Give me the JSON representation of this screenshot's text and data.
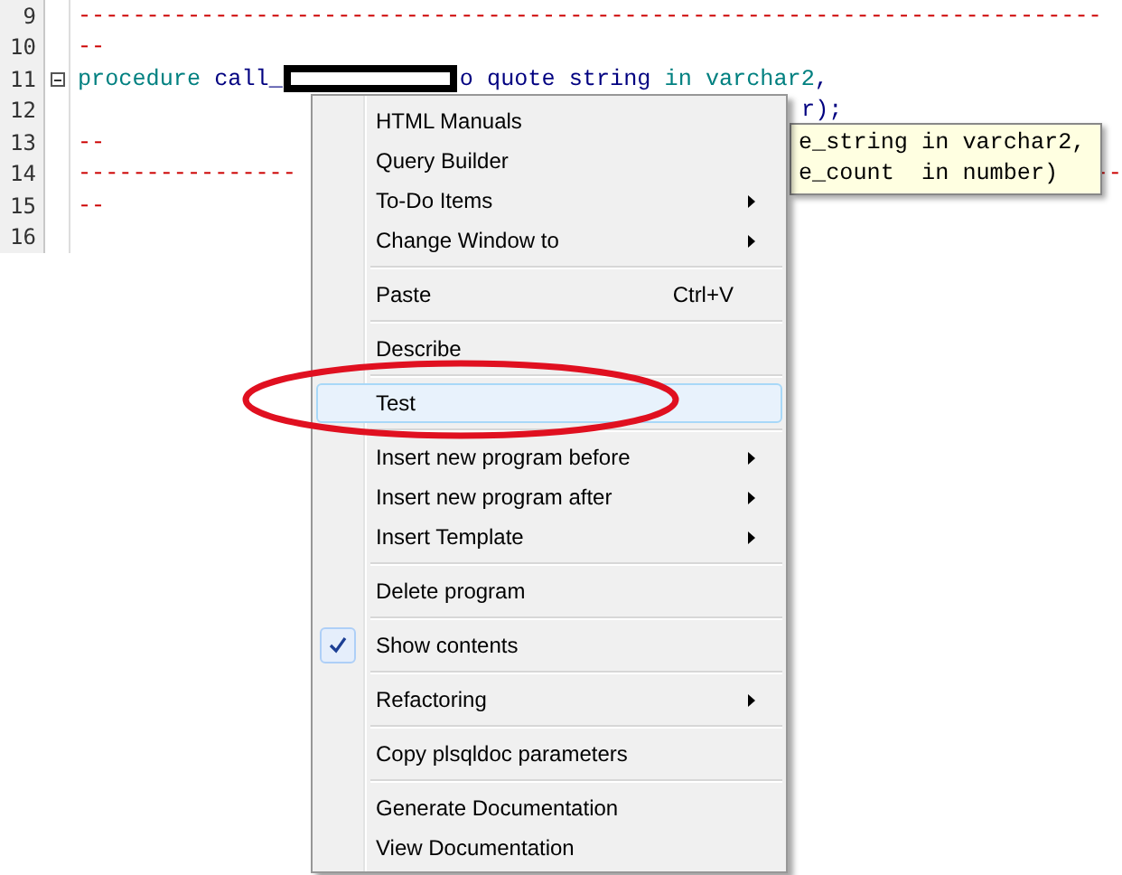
{
  "editor": {
    "lines": [
      {
        "number": "9",
        "fold_toggle": false,
        "segments": [
          {
            "kind": "comment",
            "text": "---------------------------------------------------------------------------"
          }
        ]
      },
      {
        "number": "10",
        "fold_toggle": false,
        "segments": [
          {
            "kind": "comment",
            "text": "--"
          }
        ]
      },
      {
        "number": "11",
        "fold_toggle": true,
        "segments": [
          {
            "kind": "keyword",
            "text": "procedure"
          },
          {
            "kind": "plain",
            "text": " call_"
          },
          {
            "kind": "redacted"
          },
          {
            "kind": "plain",
            "text": "o quote string "
          },
          {
            "kind": "keyword",
            "text": "in varchar2"
          },
          {
            "kind": "plain",
            "text": ","
          }
        ]
      },
      {
        "number": "12",
        "fold_toggle": false,
        "segments": [
          {
            "kind": "plain",
            "text": "                                                     r);"
          }
        ]
      },
      {
        "number": "13",
        "fold_toggle": false,
        "segments": [
          {
            "kind": "comment",
            "text": "--"
          }
        ]
      },
      {
        "number": "14",
        "fold_toggle": false,
        "segments": [
          {
            "kind": "comment",
            "text": "----------------"
          },
          {
            "kind": "tail",
            "text": "--"
          }
        ]
      },
      {
        "number": "15",
        "fold_toggle": false,
        "segments": [
          {
            "kind": "comment",
            "text": "--"
          }
        ]
      },
      {
        "number": "16",
        "fold_toggle": false
      }
    ]
  },
  "tooltip": {
    "lines": [
      "e_string in varchar2,",
      "e_count  in number)"
    ]
  },
  "context_menu": {
    "items": [
      {
        "kind": "item",
        "label": "HTML Manuals",
        "submenu": false,
        "checked": false,
        "selected": false
      },
      {
        "kind": "item",
        "label": "Query Builder",
        "submenu": false,
        "checked": false,
        "selected": false
      },
      {
        "kind": "item",
        "label": "To-Do Items",
        "submenu": true,
        "checked": false,
        "selected": false
      },
      {
        "kind": "item",
        "label": "Change Window to",
        "submenu": true,
        "checked": false,
        "selected": false
      },
      {
        "kind": "separator"
      },
      {
        "kind": "item",
        "label": "Paste",
        "shortcut": "Ctrl+V",
        "submenu": false,
        "checked": false,
        "selected": false
      },
      {
        "kind": "separator"
      },
      {
        "kind": "item",
        "label": "Describe",
        "submenu": false,
        "checked": false,
        "selected": false
      },
      {
        "kind": "separator"
      },
      {
        "kind": "item",
        "label": "Test",
        "submenu": false,
        "checked": false,
        "selected": true
      },
      {
        "kind": "separator"
      },
      {
        "kind": "item",
        "label": "Insert new program before",
        "submenu": true,
        "checked": false,
        "selected": false
      },
      {
        "kind": "item",
        "label": "Insert new program after",
        "submenu": true,
        "checked": false,
        "selected": false
      },
      {
        "kind": "item",
        "label": "Insert Template",
        "submenu": true,
        "checked": false,
        "selected": false
      },
      {
        "kind": "separator"
      },
      {
        "kind": "item",
        "label": "Delete program",
        "submenu": false,
        "checked": false,
        "selected": false
      },
      {
        "kind": "separator"
      },
      {
        "kind": "item",
        "label": "Show contents",
        "submenu": false,
        "checked": true,
        "selected": false
      },
      {
        "kind": "separator"
      },
      {
        "kind": "item",
        "label": "Refactoring",
        "submenu": true,
        "checked": false,
        "selected": false
      },
      {
        "kind": "separator"
      },
      {
        "kind": "item",
        "label": "Copy plsqldoc parameters",
        "submenu": false,
        "checked": false,
        "selected": false
      },
      {
        "kind": "separator"
      },
      {
        "kind": "item",
        "label": "Generate Documentation",
        "submenu": false,
        "checked": false,
        "selected": false
      },
      {
        "kind": "item",
        "label": "View Documentation",
        "submenu": false,
        "checked": false,
        "selected": false
      }
    ]
  }
}
